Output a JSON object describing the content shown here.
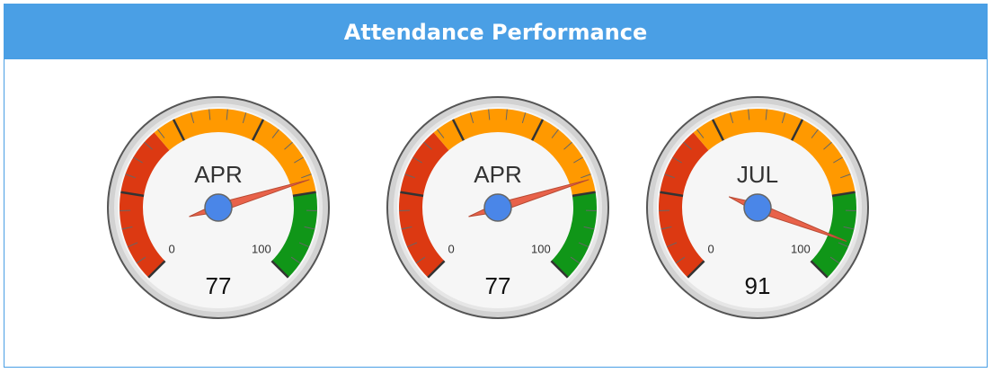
{
  "header": {
    "title": "Attendance Performance"
  },
  "chart_data": [
    {
      "type": "gauge",
      "label": "APR",
      "value": 77,
      "min": 0,
      "max": 100,
      "min_label": "0",
      "max_label": "100",
      "bands": [
        {
          "from": 0,
          "to": 35,
          "color": "#dc3912"
        },
        {
          "from": 35,
          "to": 80,
          "color": "#ff9900"
        },
        {
          "from": 80,
          "to": 100,
          "color": "#109618"
        }
      ]
    },
    {
      "type": "gauge",
      "label": "APR",
      "value": 77,
      "min": 0,
      "max": 100,
      "min_label": "0",
      "max_label": "100",
      "bands": [
        {
          "from": 0,
          "to": 35,
          "color": "#dc3912"
        },
        {
          "from": 35,
          "to": 80,
          "color": "#ff9900"
        },
        {
          "from": 80,
          "to": 100,
          "color": "#109618"
        }
      ]
    },
    {
      "type": "gauge",
      "label": "JUL",
      "value": 91,
      "min": 0,
      "max": 100,
      "min_label": "0",
      "max_label": "100",
      "bands": [
        {
          "from": 0,
          "to": 35,
          "color": "#dc3912"
        },
        {
          "from": 35,
          "to": 80,
          "color": "#ff9900"
        },
        {
          "from": 80,
          "to": 100,
          "color": "#109618"
        }
      ]
    }
  ],
  "colors": {
    "header_bg": "#4a9fe5",
    "needle": "#e8624a",
    "needle_hub": "#4a86e8"
  }
}
